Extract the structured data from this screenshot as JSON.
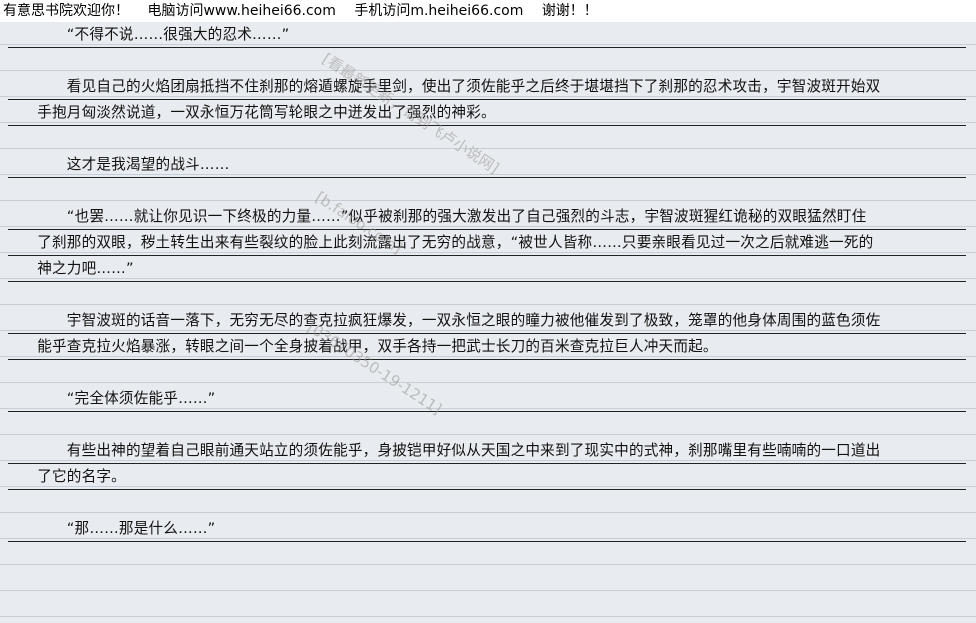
{
  "header": {
    "site": "有意思书院欢迎你！",
    "pc": "电脑访问www.heihei66.com",
    "mobile": "手机访问m.heihei66.com",
    "thanks": "谢谢！！"
  },
  "paragraphs": [
    {
      "lines": [
        "　　“不得不说……很强大的忍术……”"
      ]
    },
    {
      "lines": [
        "　　看见自己的火焰团扇抵挡不住刹那的熔遁螺旋手里剑，使出了须佐能乎之后终于堪堪挡下了刹那的忍术攻击，宇智波斑开始双",
        "手抱月匈淡然说道，一双永恒万花筒写轮眼之中迸发出了强烈的神彩。"
      ]
    },
    {
      "lines": [
        "　　这才是我渴望的战斗……"
      ]
    },
    {
      "lines": [
        "　　“也罢……就让你见识一下终极的力量……”似乎被刹那的强大激发出了自己强烈的斗志，宇智波斑猩红诡秘的双眼猛然盯住",
        "了刹那的双眼，秽土转生出来有些裂纹的脸上此刻流露出了无穷的战意，“被世人皆称……只要亲眼看见过一次之后就难逃一死的",
        "神之力吧……”"
      ]
    },
    {
      "lines": [
        "　　宇智波斑的话音一落下，无穷无尽的查克拉疯狂爆发，一双永恒之眼的瞳力被他催发到了极致，笼罩的他身体周围的蓝色须佐",
        "能乎查克拉火焰暴涨，转眼之间一个全身披着战甲，双手各持一把武士长刀的百米查克拉巨人冲天而起。"
      ]
    },
    {
      "lines": [
        "　　“完全体须佐能乎……”"
      ]
    },
    {
      "lines": [
        "　　有些出神的望着自己眼前通天站立的须佐能乎，身披铠甲好似从天国之中来到了现实中的式神，刹那嘴里有些喃喃的一口道出",
        "了它的名字。"
      ]
    },
    {
      "lines": [
        "　　“那……那是什么……”"
      ]
    }
  ],
  "watermarks": {
    "wm1": "[看最新更新，请到飞卢小说网]",
    "wm2": "[b.faloo.com]",
    "wm3": "[03670350-19-1211]"
  }
}
